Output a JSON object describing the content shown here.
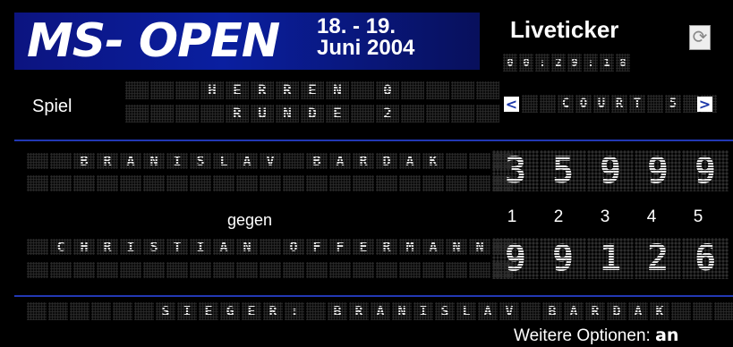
{
  "header": {
    "logo_text": "MS- OPEN",
    "date_line1": "18. - 19.",
    "date_line2": "Juni 2004",
    "liveticker_label": "Liveticker",
    "liveticker_time": "00:29:18"
  },
  "spiel_label": "Spiel",
  "match_info": {
    "line1": "HERREN 0",
    "line2": "RUNDE 2"
  },
  "court": {
    "prev_icon": "<",
    "next_icon": ">",
    "label": "COURT 5"
  },
  "player1": {
    "name": "BRANISLAV BARDAK",
    "line2": ""
  },
  "player2": {
    "name": "CHRISTIAN OFFERMANN",
    "line2": ""
  },
  "gegen_label": "gegen",
  "set_numbers": [
    "1",
    "2",
    "3",
    "4",
    "5"
  ],
  "scores": {
    "player1": [
      "3",
      "5",
      "9",
      "9",
      "9"
    ],
    "player2": [
      "9",
      "9",
      "1",
      "2",
      "6"
    ]
  },
  "winner_line": "SIEGER: BRANISLAV BARDAK",
  "options": {
    "text": "Weitere Optionen:",
    "toggle": "an"
  },
  "colors": {
    "banner": "#0a1fa0",
    "separator": "#2238b4",
    "background": "#000000",
    "arrow": "#1b36a8"
  },
  "icons": {
    "refresh": "refresh-icon",
    "prev": "left-arrow-icon",
    "next": "right-arrow-icon"
  }
}
